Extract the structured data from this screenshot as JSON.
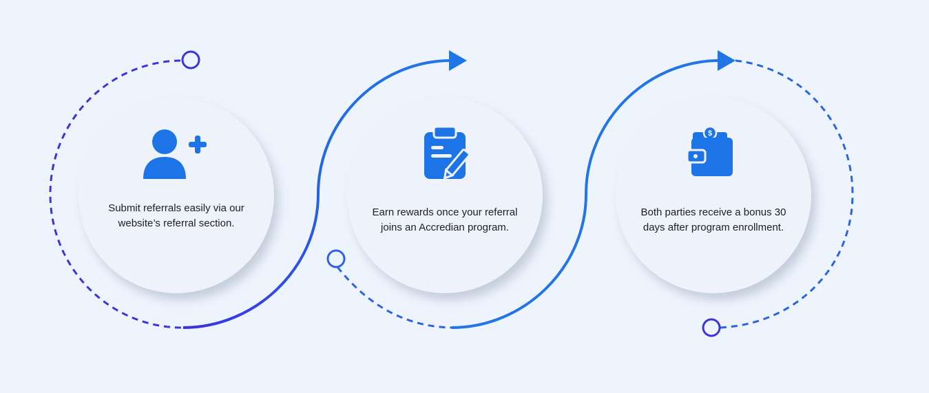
{
  "colors": {
    "background": "#eef4fd",
    "card": "#eef3fb",
    "icon_blue": "#1d74e7",
    "path_blue": "#2275e6",
    "path_indigo": "#3a33e0"
  },
  "steps": [
    {
      "icon": "add-user-icon",
      "text": "Submit referrals easily via our website’s referral section."
    },
    {
      "icon": "clipboard-edit-icon",
      "text": "Earn rewards once your referral joins an Accredian program."
    },
    {
      "icon": "wallet-icon",
      "text": "Both parties receive a bonus 30 days after program enrollment."
    }
  ]
}
